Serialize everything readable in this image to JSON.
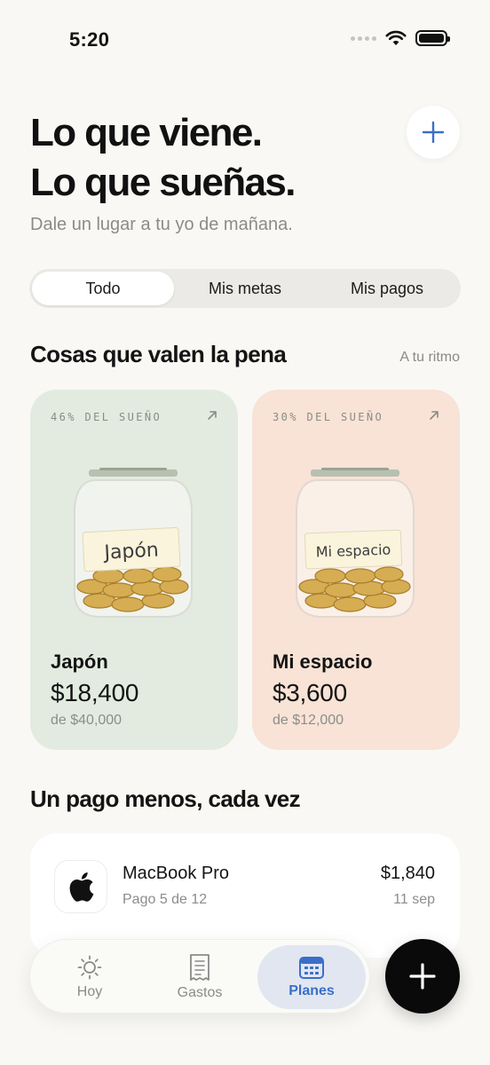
{
  "status": {
    "time": "5:20"
  },
  "header": {
    "title_line1": "Lo que viene.",
    "title_line2": "Lo que sueñas.",
    "subtitle": "Dale un lugar a tu yo de mañana."
  },
  "segments": {
    "items": [
      "Todo",
      "Mis metas",
      "Mis pagos"
    ],
    "selected": "Todo"
  },
  "goals_section": {
    "title": "Cosas que valen la pena",
    "link": "A tu ritmo",
    "goals": [
      {
        "progress_label": "46% DEL SUEÑO",
        "jar_label": "Japón",
        "name": "Japón",
        "amount": "$18,400",
        "target": "de $40,000",
        "progress": 0.46,
        "bg": "#e3ebe0"
      },
      {
        "progress_label": "30% DEL SUEÑO",
        "jar_label": "Mi espacio",
        "name": "Mi espacio",
        "amount": "$3,600",
        "target": "de $12,000",
        "progress": 0.3,
        "bg": "#f8e3d6"
      }
    ]
  },
  "payments_section": {
    "title": "Un pago menos, cada vez",
    "items": [
      {
        "icon": "apple-logo-icon",
        "name": "MacBook Pro",
        "detail": "Pago 5 de 12",
        "amount": "$1,840",
        "date": "11 sep"
      }
    ]
  },
  "tabbar": {
    "tabs": [
      {
        "label": "Hoy",
        "icon": "sun-icon"
      },
      {
        "label": "Gastos",
        "icon": "receipt-icon"
      },
      {
        "label": "Planes",
        "icon": "calendar-icon"
      }
    ],
    "active": "Planes"
  },
  "colors": {
    "accent": "#3a6fc7",
    "background": "#f9f8f4",
    "fab": "#0a0a0a"
  }
}
